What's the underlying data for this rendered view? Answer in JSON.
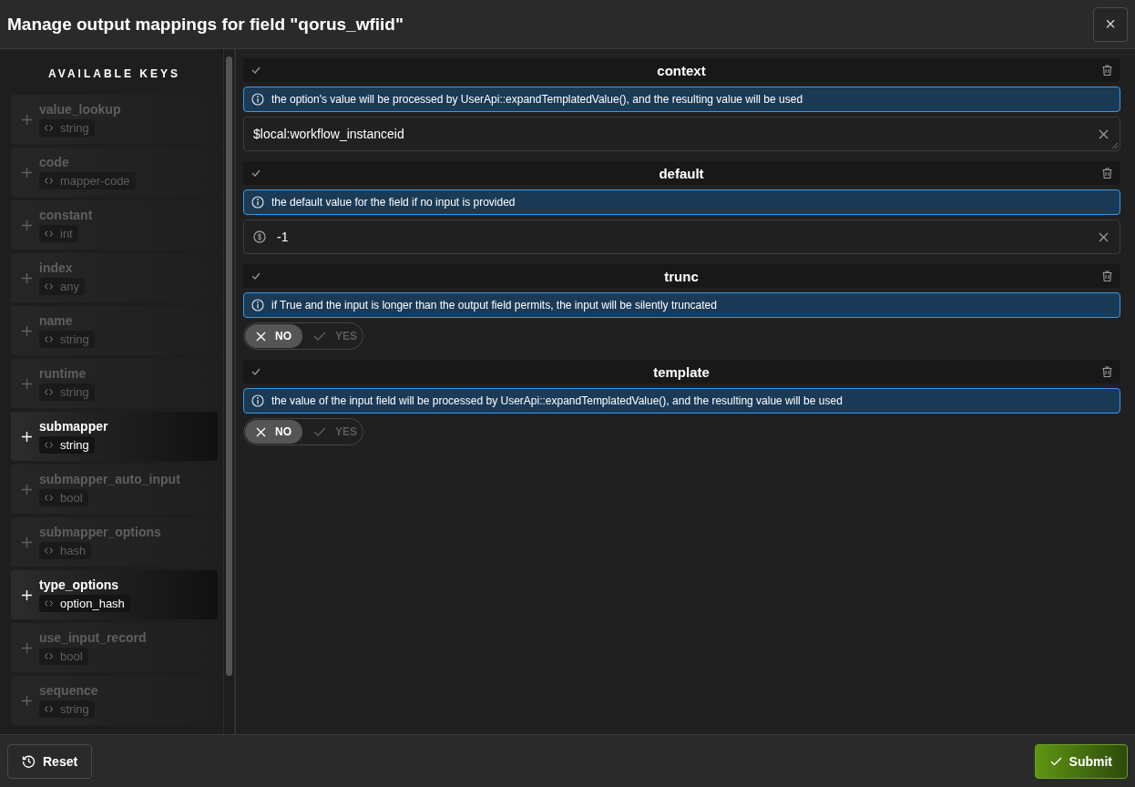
{
  "dialog": {
    "title": "Manage output mappings for field \"qorus_wfiid\"",
    "close_label": "×"
  },
  "sidebar": {
    "heading": "AVAILABLE KEYS",
    "items": [
      {
        "name": "value_lookup",
        "type": "string",
        "disabled": true
      },
      {
        "name": "code",
        "type": "mapper-code",
        "disabled": true
      },
      {
        "name": "constant",
        "type": "int",
        "disabled": true
      },
      {
        "name": "index",
        "type": "any",
        "disabled": true
      },
      {
        "name": "name",
        "type": "string",
        "disabled": true
      },
      {
        "name": "runtime",
        "type": "string",
        "disabled": true
      },
      {
        "name": "submapper",
        "type": "string",
        "disabled": false
      },
      {
        "name": "submapper_auto_input",
        "type": "bool",
        "disabled": true
      },
      {
        "name": "submapper_options",
        "type": "hash",
        "disabled": true
      },
      {
        "name": "type_options",
        "type": "option_hash",
        "disabled": false
      },
      {
        "name": "use_input_record",
        "type": "bool",
        "disabled": true
      },
      {
        "name": "sequence",
        "type": "string",
        "disabled": true
      }
    ]
  },
  "options": [
    {
      "title": "context",
      "info": "the option's value will be processed by UserApi::expandTemplatedValue(), and the resulting value will be used",
      "kind": "textarea",
      "value": "$local:workflow_instanceid"
    },
    {
      "title": "default",
      "info": "the default value for the field if no input is provided",
      "kind": "number",
      "value": "-1"
    },
    {
      "title": "trunc",
      "info": "if True and the input is longer than the output field permits, the input will be silently truncated",
      "kind": "toggle",
      "choices": [
        {
          "label": "NO",
          "selected": true
        },
        {
          "label": "YES",
          "selected": false
        }
      ]
    },
    {
      "title": "template",
      "info": "the value of the input field will be processed by UserApi::expandTemplatedValue(), and the resulting value will be used",
      "kind": "toggle",
      "choices": [
        {
          "label": "NO",
          "selected": true
        },
        {
          "label": "YES",
          "selected": false
        }
      ]
    }
  ],
  "footer": {
    "reset_label": "Reset",
    "submit_label": "Submit"
  }
}
